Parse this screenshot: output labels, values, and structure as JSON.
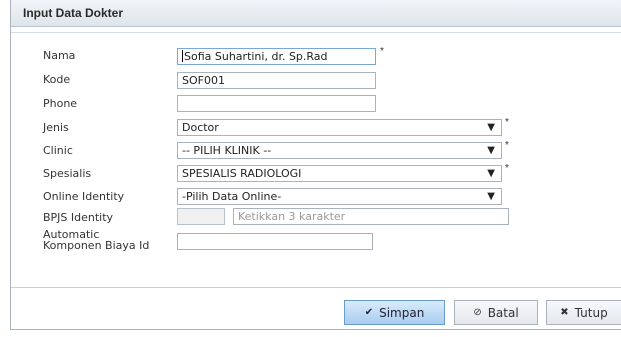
{
  "dialog": {
    "title": "Input Data Dokter"
  },
  "form": {
    "nama": {
      "label": "Nama",
      "value": "Sofia Suhartini, dr. Sp.Rad",
      "required": "*"
    },
    "kode": {
      "label": "Kode",
      "value": "SOF001"
    },
    "phone": {
      "label": "Phone",
      "value": ""
    },
    "jenis": {
      "label": "Jenis",
      "value": "Doctor",
      "required": "*"
    },
    "clinic": {
      "label": "Clinic",
      "value": "-- PILIH KLINIK --",
      "required": "*"
    },
    "spesialis": {
      "label": "Spesialis",
      "value": "SPESIALIS RADIOLOGI",
      "required": "*"
    },
    "online_identity": {
      "label": "Online Identity",
      "value": "-Pilih Data Online-"
    },
    "bpjs_identity": {
      "label": "BPJS Identity",
      "placeholder": "Ketikkan 3 karakter"
    },
    "automatic": {
      "label_line1": "Automatic",
      "label_line2": "Komponen Biaya Id",
      "value": ""
    }
  },
  "icons": {
    "dropdown": "chevron-down-icon"
  },
  "buttons": {
    "simpan": {
      "label": "Simpan",
      "icon": "check-icon"
    },
    "batal": {
      "label": "Batal",
      "icon": "cancel-icon"
    },
    "tutup": {
      "label": "Tutup",
      "icon": "close-icon"
    }
  }
}
